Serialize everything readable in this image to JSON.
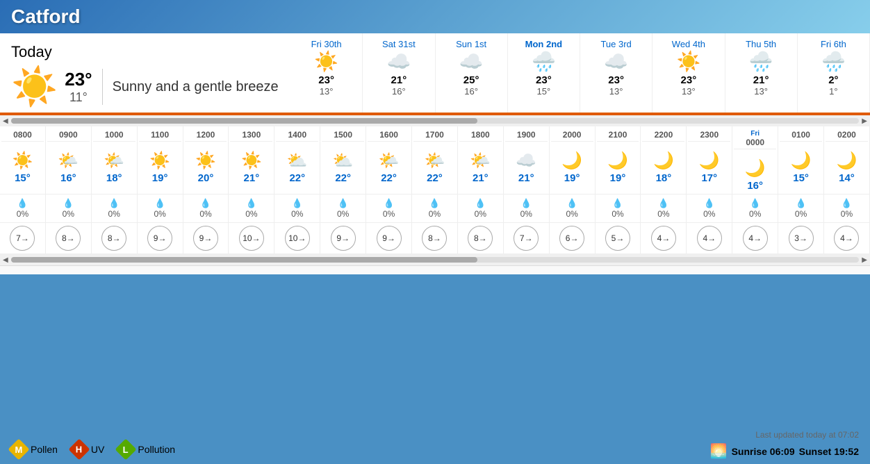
{
  "header": {
    "city": "Catford",
    "background_color": "#4a90c4"
  },
  "today": {
    "label": "Today",
    "high": "23°",
    "low": "11°",
    "description": "Sunny and a gentle breeze",
    "icon": "☀️"
  },
  "forecast_days": [
    {
      "label": "Fri 30th",
      "icon": "☀️",
      "high": "23°",
      "low": "13°",
      "highlight": false
    },
    {
      "label": "Sat 31st",
      "icon": "☁️",
      "high": "21°",
      "low": "16°",
      "highlight": false
    },
    {
      "label": "Sun 1st",
      "icon": "☁️",
      "high": "25°",
      "low": "16°",
      "highlight": false
    },
    {
      "label": "Mon 2nd",
      "icon": "🌧️",
      "high": "23°",
      "low": "15°",
      "highlight": true
    },
    {
      "label": "Tue 3rd",
      "icon": "☁️",
      "high": "23°",
      "low": "13°",
      "highlight": false
    },
    {
      "label": "Wed 4th",
      "icon": "☀️",
      "high": "23°",
      "low": "13°",
      "highlight": false
    },
    {
      "label": "Thu 5th",
      "icon": "🌧️",
      "high": "21°",
      "low": "13°",
      "highlight": false
    },
    {
      "label": "Fri 6th",
      "icon": "🌧️",
      "high": "2°",
      "low": "1°",
      "highlight": false
    }
  ],
  "hourly": [
    {
      "time": "0800",
      "icon": "☀️",
      "temp": "15°",
      "rain_pct": "0%",
      "wind_speed": 7,
      "wind_dir": "→"
    },
    {
      "time": "0900",
      "icon": "🌤️",
      "temp": "16°",
      "rain_pct": "0%",
      "wind_speed": 8,
      "wind_dir": "→"
    },
    {
      "time": "1000",
      "icon": "🌤️",
      "temp": "18°",
      "rain_pct": "0%",
      "wind_speed": 8,
      "wind_dir": "→"
    },
    {
      "time": "1100",
      "icon": "☀️",
      "temp": "19°",
      "rain_pct": "0%",
      "wind_speed": 9,
      "wind_dir": "→"
    },
    {
      "time": "1200",
      "icon": "☀️",
      "temp": "20°",
      "rain_pct": "0%",
      "wind_speed": 9,
      "wind_dir": "→"
    },
    {
      "time": "1300",
      "icon": "☀️",
      "temp": "21°",
      "rain_pct": "0%",
      "wind_speed": 10,
      "wind_dir": "→"
    },
    {
      "time": "1400",
      "icon": "⛅",
      "temp": "22°",
      "rain_pct": "0%",
      "wind_speed": 10,
      "wind_dir": "→"
    },
    {
      "time": "1500",
      "icon": "⛅",
      "temp": "22°",
      "rain_pct": "0%",
      "wind_speed": 9,
      "wind_dir": "→"
    },
    {
      "time": "1600",
      "icon": "🌤️",
      "temp": "22°",
      "rain_pct": "0%",
      "wind_speed": 9,
      "wind_dir": "→"
    },
    {
      "time": "1700",
      "icon": "🌤️",
      "temp": "22°",
      "rain_pct": "0%",
      "wind_speed": 8,
      "wind_dir": "→"
    },
    {
      "time": "1800",
      "icon": "🌤️",
      "temp": "21°",
      "rain_pct": "0%",
      "wind_speed": 8,
      "wind_dir": "→"
    },
    {
      "time": "1900",
      "icon": "☁️",
      "temp": "21°",
      "rain_pct": "0%",
      "wind_speed": 7,
      "wind_dir": "→"
    },
    {
      "time": "2000",
      "icon": "🌙",
      "temp": "19°",
      "rain_pct": "0%",
      "wind_speed": 6,
      "wind_dir": "→"
    },
    {
      "time": "2100",
      "icon": "🌙",
      "temp": "19°",
      "rain_pct": "0%",
      "wind_speed": 5,
      "wind_dir": "→"
    },
    {
      "time": "2200",
      "icon": "🌙",
      "temp": "18°",
      "rain_pct": "0%",
      "wind_speed": 4,
      "wind_dir": "→"
    },
    {
      "time": "2300",
      "icon": "🌙",
      "temp": "17°",
      "rain_pct": "0%",
      "wind_speed": 4,
      "wind_dir": "→"
    },
    {
      "time": "0000",
      "icon": "🌙",
      "temp": "16°",
      "rain_pct": "0%",
      "wind_speed": 4,
      "wind_dir": "→",
      "day_label": "Fri"
    },
    {
      "time": "0100",
      "icon": "🌙",
      "temp": "15°",
      "rain_pct": "0%",
      "wind_speed": 3,
      "wind_dir": "→"
    },
    {
      "time": "0200",
      "icon": "🌙",
      "temp": "14°",
      "rain_pct": "0%",
      "wind_speed": 4,
      "wind_dir": "→"
    }
  ],
  "footer": {
    "pollen_label": "Pollen",
    "pollen_letter": "M",
    "uv_label": "UV",
    "uv_letter": "H",
    "pollution_label": "Pollution",
    "pollution_letter": "L",
    "last_updated": "Last updated today at 07:02",
    "sunrise_label": "Sunrise 06:09",
    "sunset_label": "Sunset 19:52"
  }
}
